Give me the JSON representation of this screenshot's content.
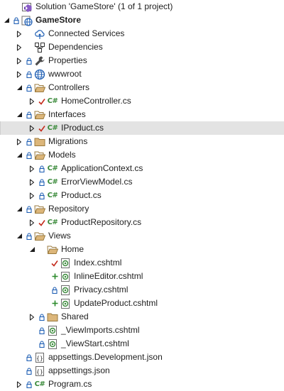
{
  "solution_explorer": {
    "rows": [
      {
        "name": "solution-node",
        "label": "Solution 'GameStore' (1 of 1 project)",
        "icon": "solution-icon",
        "depth": 0,
        "expander": "none",
        "status": "none"
      },
      {
        "name": "project-node",
        "label": "GameStore",
        "icon": "web-project-icon",
        "depth": 0,
        "expander": "expanded",
        "status": "lock",
        "bold": true
      },
      {
        "name": "connected-services-node",
        "label": "Connected Services",
        "icon": "connected-services-icon",
        "depth": 1,
        "expander": "collapsed",
        "status": "none"
      },
      {
        "name": "dependencies-node",
        "label": "Dependencies",
        "icon": "dependencies-icon",
        "depth": 1,
        "expander": "collapsed",
        "status": "none"
      },
      {
        "name": "properties-node",
        "label": "Properties",
        "icon": "properties-wrench-icon",
        "depth": 1,
        "expander": "collapsed",
        "status": "lock"
      },
      {
        "name": "wwwroot-node",
        "label": "wwwroot",
        "icon": "globe-icon",
        "depth": 1,
        "expander": "collapsed",
        "status": "lock"
      },
      {
        "name": "controllers-folder",
        "label": "Controllers",
        "icon": "folder-open-icon",
        "depth": 1,
        "expander": "expanded",
        "status": "lock"
      },
      {
        "name": "home-controller-file",
        "label": "HomeController.cs",
        "icon": "csharp-file-icon",
        "depth": 2,
        "expander": "collapsed",
        "status": "check"
      },
      {
        "name": "interfaces-folder",
        "label": "Interfaces",
        "icon": "folder-open-icon",
        "depth": 1,
        "expander": "expanded",
        "status": "lock"
      },
      {
        "name": "iproduct-file",
        "label": "IProduct.cs",
        "icon": "csharp-file-icon",
        "depth": 2,
        "expander": "collapsed",
        "status": "check",
        "selected": true
      },
      {
        "name": "migrations-folder",
        "label": "Migrations",
        "icon": "folder-icon",
        "depth": 1,
        "expander": "collapsed",
        "status": "lock"
      },
      {
        "name": "models-folder",
        "label": "Models",
        "icon": "folder-open-icon",
        "depth": 1,
        "expander": "expanded",
        "status": "lock"
      },
      {
        "name": "application-context-file",
        "label": "ApplicationContext.cs",
        "icon": "csharp-file-icon",
        "depth": 2,
        "expander": "collapsed",
        "status": "lock"
      },
      {
        "name": "error-view-model-file",
        "label": "ErrorViewModel.cs",
        "icon": "csharp-file-icon",
        "depth": 2,
        "expander": "collapsed",
        "status": "lock"
      },
      {
        "name": "product-file",
        "label": "Product.cs",
        "icon": "csharp-file-icon",
        "depth": 2,
        "expander": "collapsed",
        "status": "lock"
      },
      {
        "name": "repository-folder",
        "label": "Repository",
        "icon": "folder-open-icon",
        "depth": 1,
        "expander": "expanded",
        "status": "lock"
      },
      {
        "name": "product-repository-file",
        "label": "ProductRepository.cs",
        "icon": "csharp-file-icon",
        "depth": 2,
        "expander": "collapsed",
        "status": "check"
      },
      {
        "name": "views-folder",
        "label": "Views",
        "icon": "folder-open-icon",
        "depth": 1,
        "expander": "expanded",
        "status": "lock"
      },
      {
        "name": "home-views-folder",
        "label": "Home",
        "icon": "folder-open-icon",
        "depth": 2,
        "expander": "expanded",
        "status": "none"
      },
      {
        "name": "index-cshtml-file",
        "label": "Index.cshtml",
        "icon": "razor-file-icon",
        "depth": 3,
        "expander": "none",
        "status": "check"
      },
      {
        "name": "inline-editor-cshtml-file",
        "label": "InlineEditor.cshtml",
        "icon": "razor-file-icon",
        "depth": 3,
        "expander": "none",
        "status": "plus"
      },
      {
        "name": "privacy-cshtml-file",
        "label": "Privacy.cshtml",
        "icon": "razor-file-icon",
        "depth": 3,
        "expander": "none",
        "status": "lock"
      },
      {
        "name": "update-product-cshtml-file",
        "label": "UpdateProduct.cshtml",
        "icon": "razor-file-icon",
        "depth": 3,
        "expander": "none",
        "status": "plus"
      },
      {
        "name": "shared-views-folder",
        "label": "Shared",
        "icon": "folder-icon",
        "depth": 2,
        "expander": "collapsed",
        "status": "lock"
      },
      {
        "name": "view-imports-file",
        "label": "_ViewImports.cshtml",
        "icon": "razor-file-icon",
        "depth": 2,
        "expander": "none",
        "status": "lock"
      },
      {
        "name": "view-start-file",
        "label": "_ViewStart.cshtml",
        "icon": "razor-file-icon",
        "depth": 2,
        "expander": "none",
        "status": "lock"
      },
      {
        "name": "appsettings-development-file",
        "label": "appsettings.Development.json",
        "icon": "json-file-icon",
        "depth": 1,
        "expander": "none",
        "status": "lock"
      },
      {
        "name": "appsettings-file",
        "label": "appsettings.json",
        "icon": "json-file-icon",
        "depth": 1,
        "expander": "none",
        "status": "lock"
      },
      {
        "name": "program-file",
        "label": "Program.cs",
        "icon": "csharp-file-icon",
        "depth": 1,
        "expander": "collapsed",
        "status": "lock"
      }
    ],
    "colors": {
      "selection": "#e3e3e3",
      "folder": "#dcb67a",
      "lock": "#1f5fb4",
      "check": "#c42b1c",
      "plus": "#2b8a2b",
      "csharp": "#3a8a3a"
    }
  }
}
